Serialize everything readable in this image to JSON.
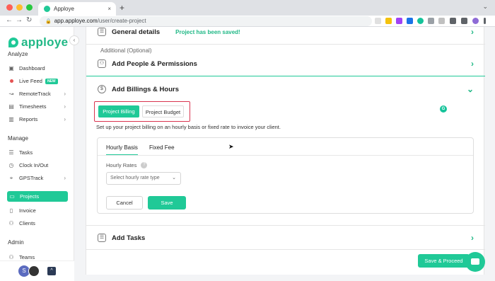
{
  "browser": {
    "tab_title": "Apploye",
    "tab_close": "×",
    "new_tab": "+",
    "url_host": "app.apploye.com",
    "url_path": "/user/create-project",
    "back": "←",
    "forward": "→",
    "reload": "↻",
    "lock": "🔒",
    "tabs_menu": "⌄",
    "window_dots": [
      "#ff5f57",
      "#febc2e",
      "#28c840"
    ]
  },
  "sidebar": {
    "logo": "apploye",
    "collapse": "‹",
    "sections": {
      "analyze": "Analyze",
      "manage": "Manage",
      "admin": "Admin"
    },
    "items": [
      {
        "label": "Dashboard",
        "icon": "dashboard-icon",
        "glyph": "▣"
      },
      {
        "label": "Live Feed",
        "badge": "NEW"
      },
      {
        "label": "RemoteTrack",
        "icon": "remote-track-icon",
        "glyph": "↝",
        "arrow": "›"
      },
      {
        "label": "Timesheets",
        "icon": "timesheets-icon",
        "glyph": "▤",
        "arrow": "›"
      },
      {
        "label": "Reports",
        "icon": "reports-icon",
        "glyph": "▥",
        "arrow": "›"
      },
      {
        "label": "Tasks",
        "icon": "tasks-icon",
        "glyph": "☰"
      },
      {
        "label": "Clock In/Out",
        "icon": "clock-icon",
        "glyph": "◷"
      },
      {
        "label": "GPSTrack",
        "icon": "gps-icon",
        "glyph": "⌖",
        "arrow": "›"
      },
      {
        "label": "Projects",
        "icon": "projects-icon",
        "glyph": "▭"
      },
      {
        "label": "Invoice",
        "icon": "invoice-icon",
        "glyph": "▯"
      },
      {
        "label": "Clients",
        "icon": "clients-icon",
        "glyph": "⚇"
      },
      {
        "label": "Teams",
        "icon": "teams-icon",
        "glyph": "⚇"
      }
    ],
    "avatar_initial": "S",
    "up_glyph": "^"
  },
  "main": {
    "general_details": {
      "title": "General details",
      "saved": "Project has been saved!",
      "glyph": "☰"
    },
    "additional_label": "Additional (Optional)",
    "people": {
      "title": "Add People & Permissions",
      "glyph": "⚇"
    },
    "billing": {
      "title": "Add Billings & Hours",
      "glyph": "$",
      "tabs": [
        "Project Billing",
        "Project Budget"
      ],
      "description": "Set up your project billing on an hourly basis or fixed rate to invoice your client.",
      "inner_tabs": [
        "Hourly Basis",
        "Fixed Fee"
      ],
      "rates_label": "Hourly Rates",
      "help": "?",
      "select_placeholder": "Select hourly rate type",
      "select_caret": "⌄",
      "cancel": "Cancel",
      "save": "Save"
    },
    "tasks": {
      "title": "Add Tasks",
      "glyph": "☰"
    },
    "save_proceed": "Save & Proceed",
    "arrow_right": "›",
    "arrow_down": "⌄",
    "grammarly": "G"
  },
  "colors": {
    "brand": "#20c997",
    "highlight_border": "#d9334f"
  }
}
